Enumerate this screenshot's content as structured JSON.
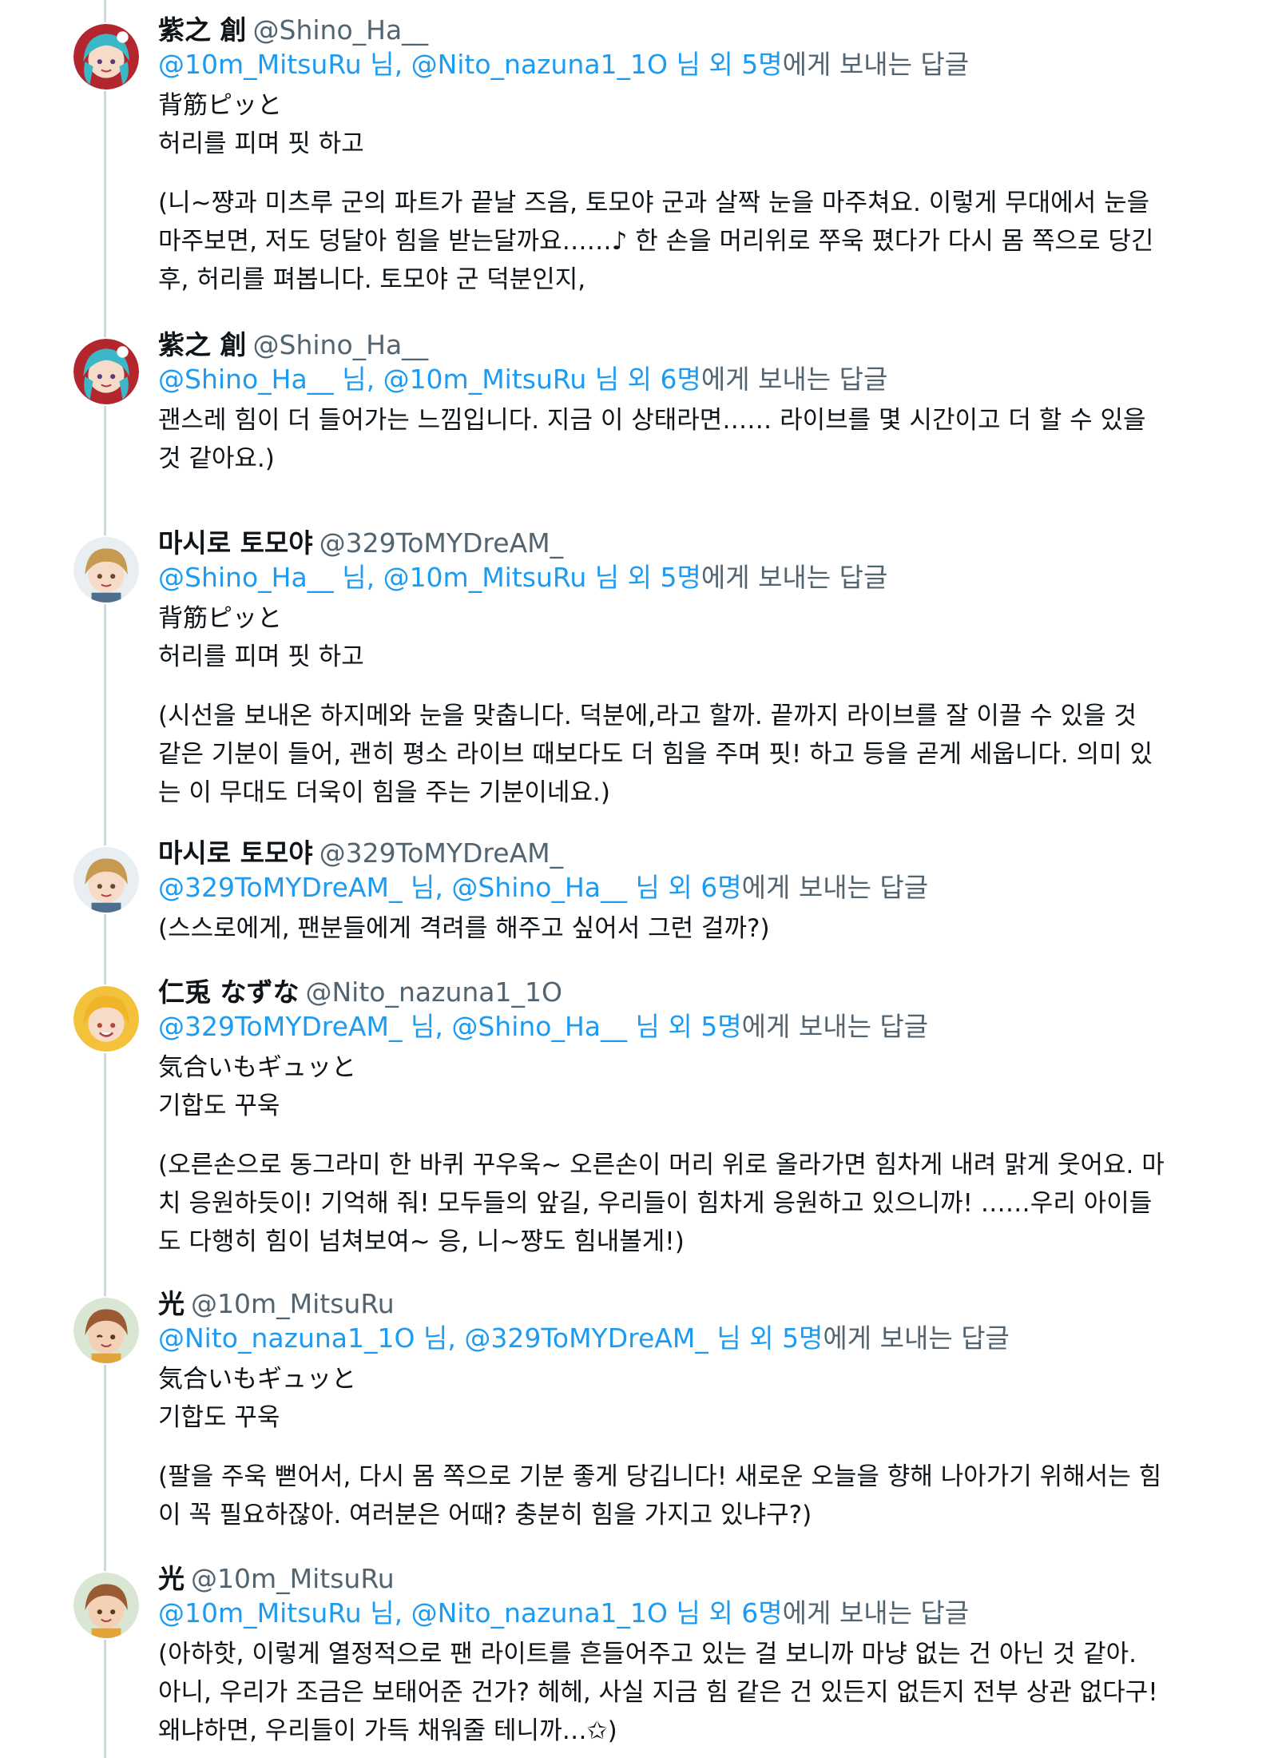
{
  "ui": {
    "reply_word": "에게 보내는 답글",
    "nim": "님",
    "others": "외"
  },
  "tweets": [
    {
      "name": "紫之 創",
      "handle": "@Shino_Ha__",
      "reply_to": [
        "@10m_MitsuRu",
        "@Nito_nazuna1_1O"
      ],
      "others_count": "5명",
      "lines": [
        "背筋ピッと",
        "허리를 피며 핏 하고"
      ],
      "paragraph": "(니~쨩과 미츠루 군의 파트가 끝날 즈음, 토모야 군과 살짝 눈을 마주쳐요. 이렇게 무대에서 눈을 마주보면, 저도 덩달아 힘을 받는달까요……♪ 한 손을 머리위로 쭈욱 폈다가 다시 몸 쪽으로 당긴 후, 허리를 펴봅니다. 토모야 군 덕분인지,",
      "avatar": "hajime"
    },
    {
      "name": "紫之 創",
      "handle": "@Shino_Ha__",
      "reply_to": [
        "@Shino_Ha__",
        "@10m_MitsuRu"
      ],
      "others_count": "6명",
      "lines": [],
      "paragraph": "괜스레 힘이 더 들어가는 느낌입니다. 지금 이 상태라면…… 라이브를 몇 시간이고 더 할 수 있을 것 같아요.)",
      "avatar": "hajime"
    },
    {
      "name": "마시로 토모야",
      "handle": "@329ToMYDreAM_",
      "reply_to": [
        "@Shino_Ha__",
        "@10m_MitsuRu"
      ],
      "others_count": "5명",
      "lines": [
        "背筋ピッと",
        "허리를 피며 핏 하고"
      ],
      "paragraph": "(시선을 보내온 하지메와 눈을 맞춥니다. 덕분에,라고 할까. 끝까지 라이브를 잘 이끌 수 있을 것 같은 기분이 들어, 괜히 평소 라이브 때보다도 더 힘을 주며 핏! 하고 등을 곧게 세웁니다. 의미 있는 이 무대도 더욱이 힘을 주는 기분이네요.)",
      "avatar": "tomoya"
    },
    {
      "name": "마시로 토모야",
      "handle": "@329ToMYDreAM_",
      "reply_to": [
        "@329ToMYDreAM_",
        "@Shino_Ha__"
      ],
      "others_count": "6명",
      "lines": [],
      "paragraph": "(스스로에게, 팬분들에게 격려를 해주고 싶어서 그런 걸까?)",
      "avatar": "tomoya"
    },
    {
      "name": "仁兎 なずな",
      "handle": "@Nito_nazuna1_1O",
      "reply_to": [
        "@329ToMYDreAM_",
        "@Shino_Ha__"
      ],
      "others_count": "5명",
      "lines": [
        "気合いもギュッと",
        "기합도 꾸욱"
      ],
      "paragraph": "(오른손으로 동그라미 한 바퀴 꾸우욱~ 오른손이 머리 위로 올라가면 힘차게 내려 맑게 웃어요. 마치 응원하듯이! 기억해 줘! 모두들의 앞길, 우리들이 힘차게 응원하고 있으니까! ……우리 아이들도 다행히 힘이 넘쳐보여~ 응, 니~쨩도 힘내볼게!)",
      "avatar": "nazuna"
    },
    {
      "name": "光",
      "handle": "@10m_MitsuRu",
      "reply_to": [
        "@Nito_nazuna1_1O",
        "@329ToMYDreAM_"
      ],
      "others_count": "5명",
      "lines": [
        "気合いもギュッと",
        "기합도 꾸욱"
      ],
      "paragraph": "(팔을 주욱 뻗어서, 다시 몸 쪽으로 기분 좋게 당깁니다! 새로운 오늘을 향해 나아가기 위해서는 힘이 꼭 필요하잖아. 여러분은 어때? 충분히 힘을 가지고 있냐구?)",
      "avatar": "mitsuru"
    },
    {
      "name": "光",
      "handle": "@10m_MitsuRu",
      "reply_to": [
        "@10m_MitsuRu",
        "@Nito_nazuna1_1O"
      ],
      "others_count": "6명",
      "lines": [],
      "paragraph": "(아하핫, 이렇게 열정적으로 팬 라이트를 흔들어주고 있는 걸 보니까 마냥 없는 건 아닌 것 같아. 아니, 우리가 조금은 보태어준 건가? 헤헤, 사실 지금 힘 같은 건 있든지 없든지 전부 상관 없다구! 왜냐하면, 우리들이 가득 채워줄 테니까…✩)",
      "avatar": "mitsuru"
    }
  ]
}
